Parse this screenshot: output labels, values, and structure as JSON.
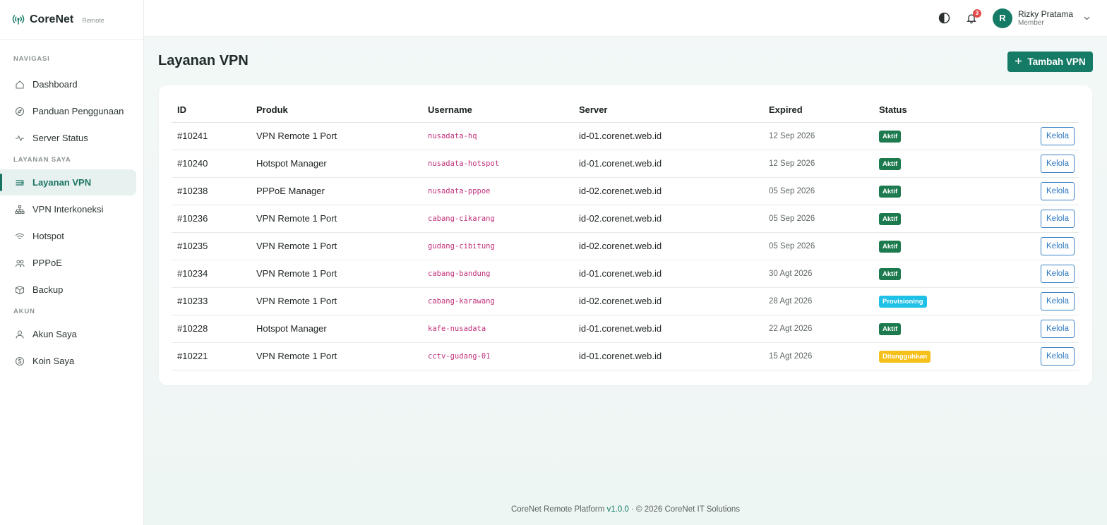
{
  "brand": {
    "name": "CoreNet",
    "tag": "Remote",
    "accent": "#157a66"
  },
  "sidebar": {
    "sections": [
      {
        "label": "NAVIGASI"
      },
      {
        "label": "LAYANAN SAYA"
      },
      {
        "label": "AKUN"
      }
    ],
    "items": [
      {
        "label": "Dashboard",
        "icon": "home-icon"
      },
      {
        "label": "Panduan Penggunaan",
        "icon": "compass-icon"
      },
      {
        "label": "Server Status",
        "icon": "pulse-icon"
      },
      {
        "label": "Layanan VPN",
        "icon": "vpn-icon",
        "active": true
      },
      {
        "label": "VPN Interkoneksi",
        "icon": "network-icon"
      },
      {
        "label": "Hotspot",
        "icon": "wifi-icon"
      },
      {
        "label": "PPPoE",
        "icon": "users-icon"
      },
      {
        "label": "Backup",
        "icon": "box-icon"
      },
      {
        "label": "Akun Saya",
        "icon": "user-icon"
      },
      {
        "label": "Koin Saya",
        "icon": "coin-icon"
      }
    ]
  },
  "topbar": {
    "notification_count": "3",
    "user": {
      "initial": "R",
      "name": "Rizky Pratama",
      "role": "Member"
    }
  },
  "main": {
    "title": "Layanan VPN",
    "add_button": "Tambah VPN",
    "columns": [
      "ID",
      "Produk",
      "Username",
      "Server",
      "Expired",
      "Status"
    ],
    "action_label": "Kelola",
    "rows": [
      {
        "id": "#10241",
        "product": "VPN Remote 1 Port",
        "username": "nusadata-hq",
        "server": "id-01.corenet.web.id",
        "expired": "12 Sep 2026",
        "status": "Aktif",
        "status_type": "aktif"
      },
      {
        "id": "#10240",
        "product": "Hotspot Manager",
        "username": "nusadata-hotspot",
        "server": "id-01.corenet.web.id",
        "expired": "12 Sep 2026",
        "status": "Aktif",
        "status_type": "aktif"
      },
      {
        "id": "#10238",
        "product": "PPPoE Manager",
        "username": "nusadata-pppoe",
        "server": "id-02.corenet.web.id",
        "expired": "05 Sep 2026",
        "status": "Aktif",
        "status_type": "aktif"
      },
      {
        "id": "#10236",
        "product": "VPN Remote 1 Port",
        "username": "cabang-cikarang",
        "server": "id-02.corenet.web.id",
        "expired": "05 Sep 2026",
        "status": "Aktif",
        "status_type": "aktif"
      },
      {
        "id": "#10235",
        "product": "VPN Remote 1 Port",
        "username": "gudang-cibitung",
        "server": "id-02.corenet.web.id",
        "expired": "05 Sep 2026",
        "status": "Aktif",
        "status_type": "aktif"
      },
      {
        "id": "#10234",
        "product": "VPN Remote 1 Port",
        "username": "cabang-bandung",
        "server": "id-01.corenet.web.id",
        "expired": "30 Agt 2026",
        "status": "Aktif",
        "status_type": "aktif"
      },
      {
        "id": "#10233",
        "product": "VPN Remote 1 Port",
        "username": "cabang-karawang",
        "server": "id-02.corenet.web.id",
        "expired": "28 Agt 2026",
        "status": "Provisioning",
        "status_type": "prov"
      },
      {
        "id": "#10228",
        "product": "Hotspot Manager",
        "username": "kafe-nusadata",
        "server": "id-01.corenet.web.id",
        "expired": "22 Agt 2026",
        "status": "Aktif",
        "status_type": "aktif"
      },
      {
        "id": "#10221",
        "product": "VPN Remote 1 Port",
        "username": "cctv-gudang-01",
        "server": "id-01.corenet.web.id",
        "expired": "15 Agt 2026",
        "status": "Ditangguhkan",
        "status_type": "tangguh"
      }
    ]
  },
  "footer": {
    "prefix": "CoreNet Remote Platform ",
    "version": "v1.0.0",
    "suffix": " · © 2026 CoreNet IT Solutions"
  }
}
